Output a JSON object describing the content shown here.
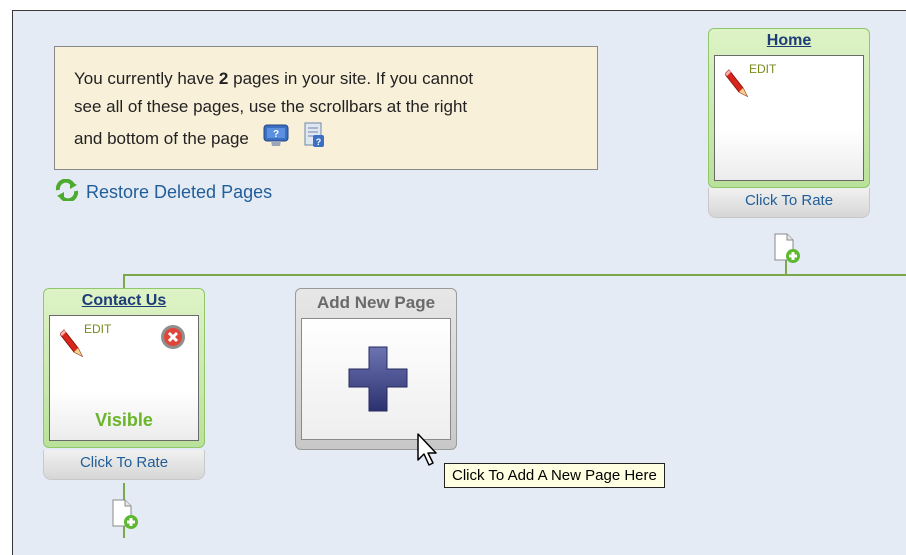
{
  "info": {
    "line1_pre": "You currently have ",
    "page_count": "2",
    "line1_post": " pages in your site. If you cannot",
    "line2": "see all of these pages, use the scrollbars at the right",
    "line3": "and bottom of the page"
  },
  "restore_label": "Restore Deleted Pages",
  "pages": [
    {
      "title": "Home",
      "edit": "EDIT",
      "rate": "Click To Rate"
    },
    {
      "title": "Contact Us",
      "edit": "EDIT",
      "status": "Visible",
      "rate": "Click To Rate"
    }
  ],
  "add_page": {
    "title": "Add New Page"
  },
  "tooltip": "Click To Add A New Page Here",
  "colors": {
    "canvas": "#e4ebf4",
    "card_green": "#b9e29a",
    "link": "#215e99",
    "visible": "#6ab52a"
  },
  "icons": [
    "help-icon",
    "document-help-icon",
    "restore-icon",
    "pencil-icon",
    "delete-icon",
    "add-page-icon",
    "plus-icon",
    "mouse-cursor-icon"
  ]
}
